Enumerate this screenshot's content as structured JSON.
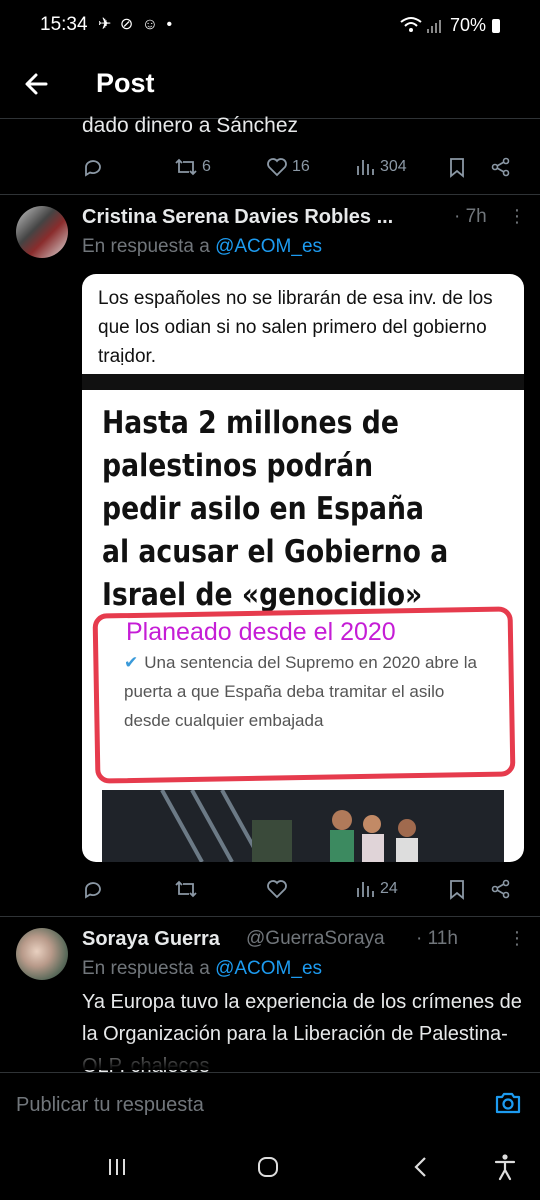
{
  "status_bar": {
    "time": "15:34",
    "icons": "✈ ⊘ ☺ •",
    "battery": "70%"
  },
  "header": {
    "title": "Post"
  },
  "prev_post": {
    "text_tail": "dado dinero a Sánchez",
    "retweets": "6",
    "likes": "16",
    "views": "304"
  },
  "reply1": {
    "name": "Cristina Serena Davies Robles ...",
    "time": "· 7h",
    "reply_prefix": "En respuesta a ",
    "reply_handle": "@ACOM_es",
    "media": {
      "top_text": "Los españoles no se librarán de esa inv. de los que los odian si no salen primero del gobierno traịdor.",
      "headline": "Hasta 2 millones de palestinos podrán pedir asilo en España al acusar el Gobierno a Israel de «genocidio»",
      "annotation": "Planeado desde el 2020",
      "subhead": "Una sentencia del Supremo en 2020 abre la puerta a que España deba tramitar el asilo desde cualquier embajada"
    },
    "views": "24"
  },
  "reply2": {
    "name": "Soraya Guerra",
    "handle": "@GuerraSoraya",
    "time": "· 11h",
    "reply_prefix": "En respuesta a ",
    "reply_handle": "@ACOM_es",
    "text": "Ya Europa tuvo la experiencia de los crímenes de la Organización para la Liberación de Palestina-OLP, chalecos"
  },
  "compose": {
    "placeholder": "Publicar tu respuesta"
  },
  "colors": {
    "background": "#000000",
    "accent": "#1d9bf0",
    "muted": "#71767b",
    "annotation_red": "#e63b4d",
    "annotation_magenta": "#c51dd6"
  }
}
